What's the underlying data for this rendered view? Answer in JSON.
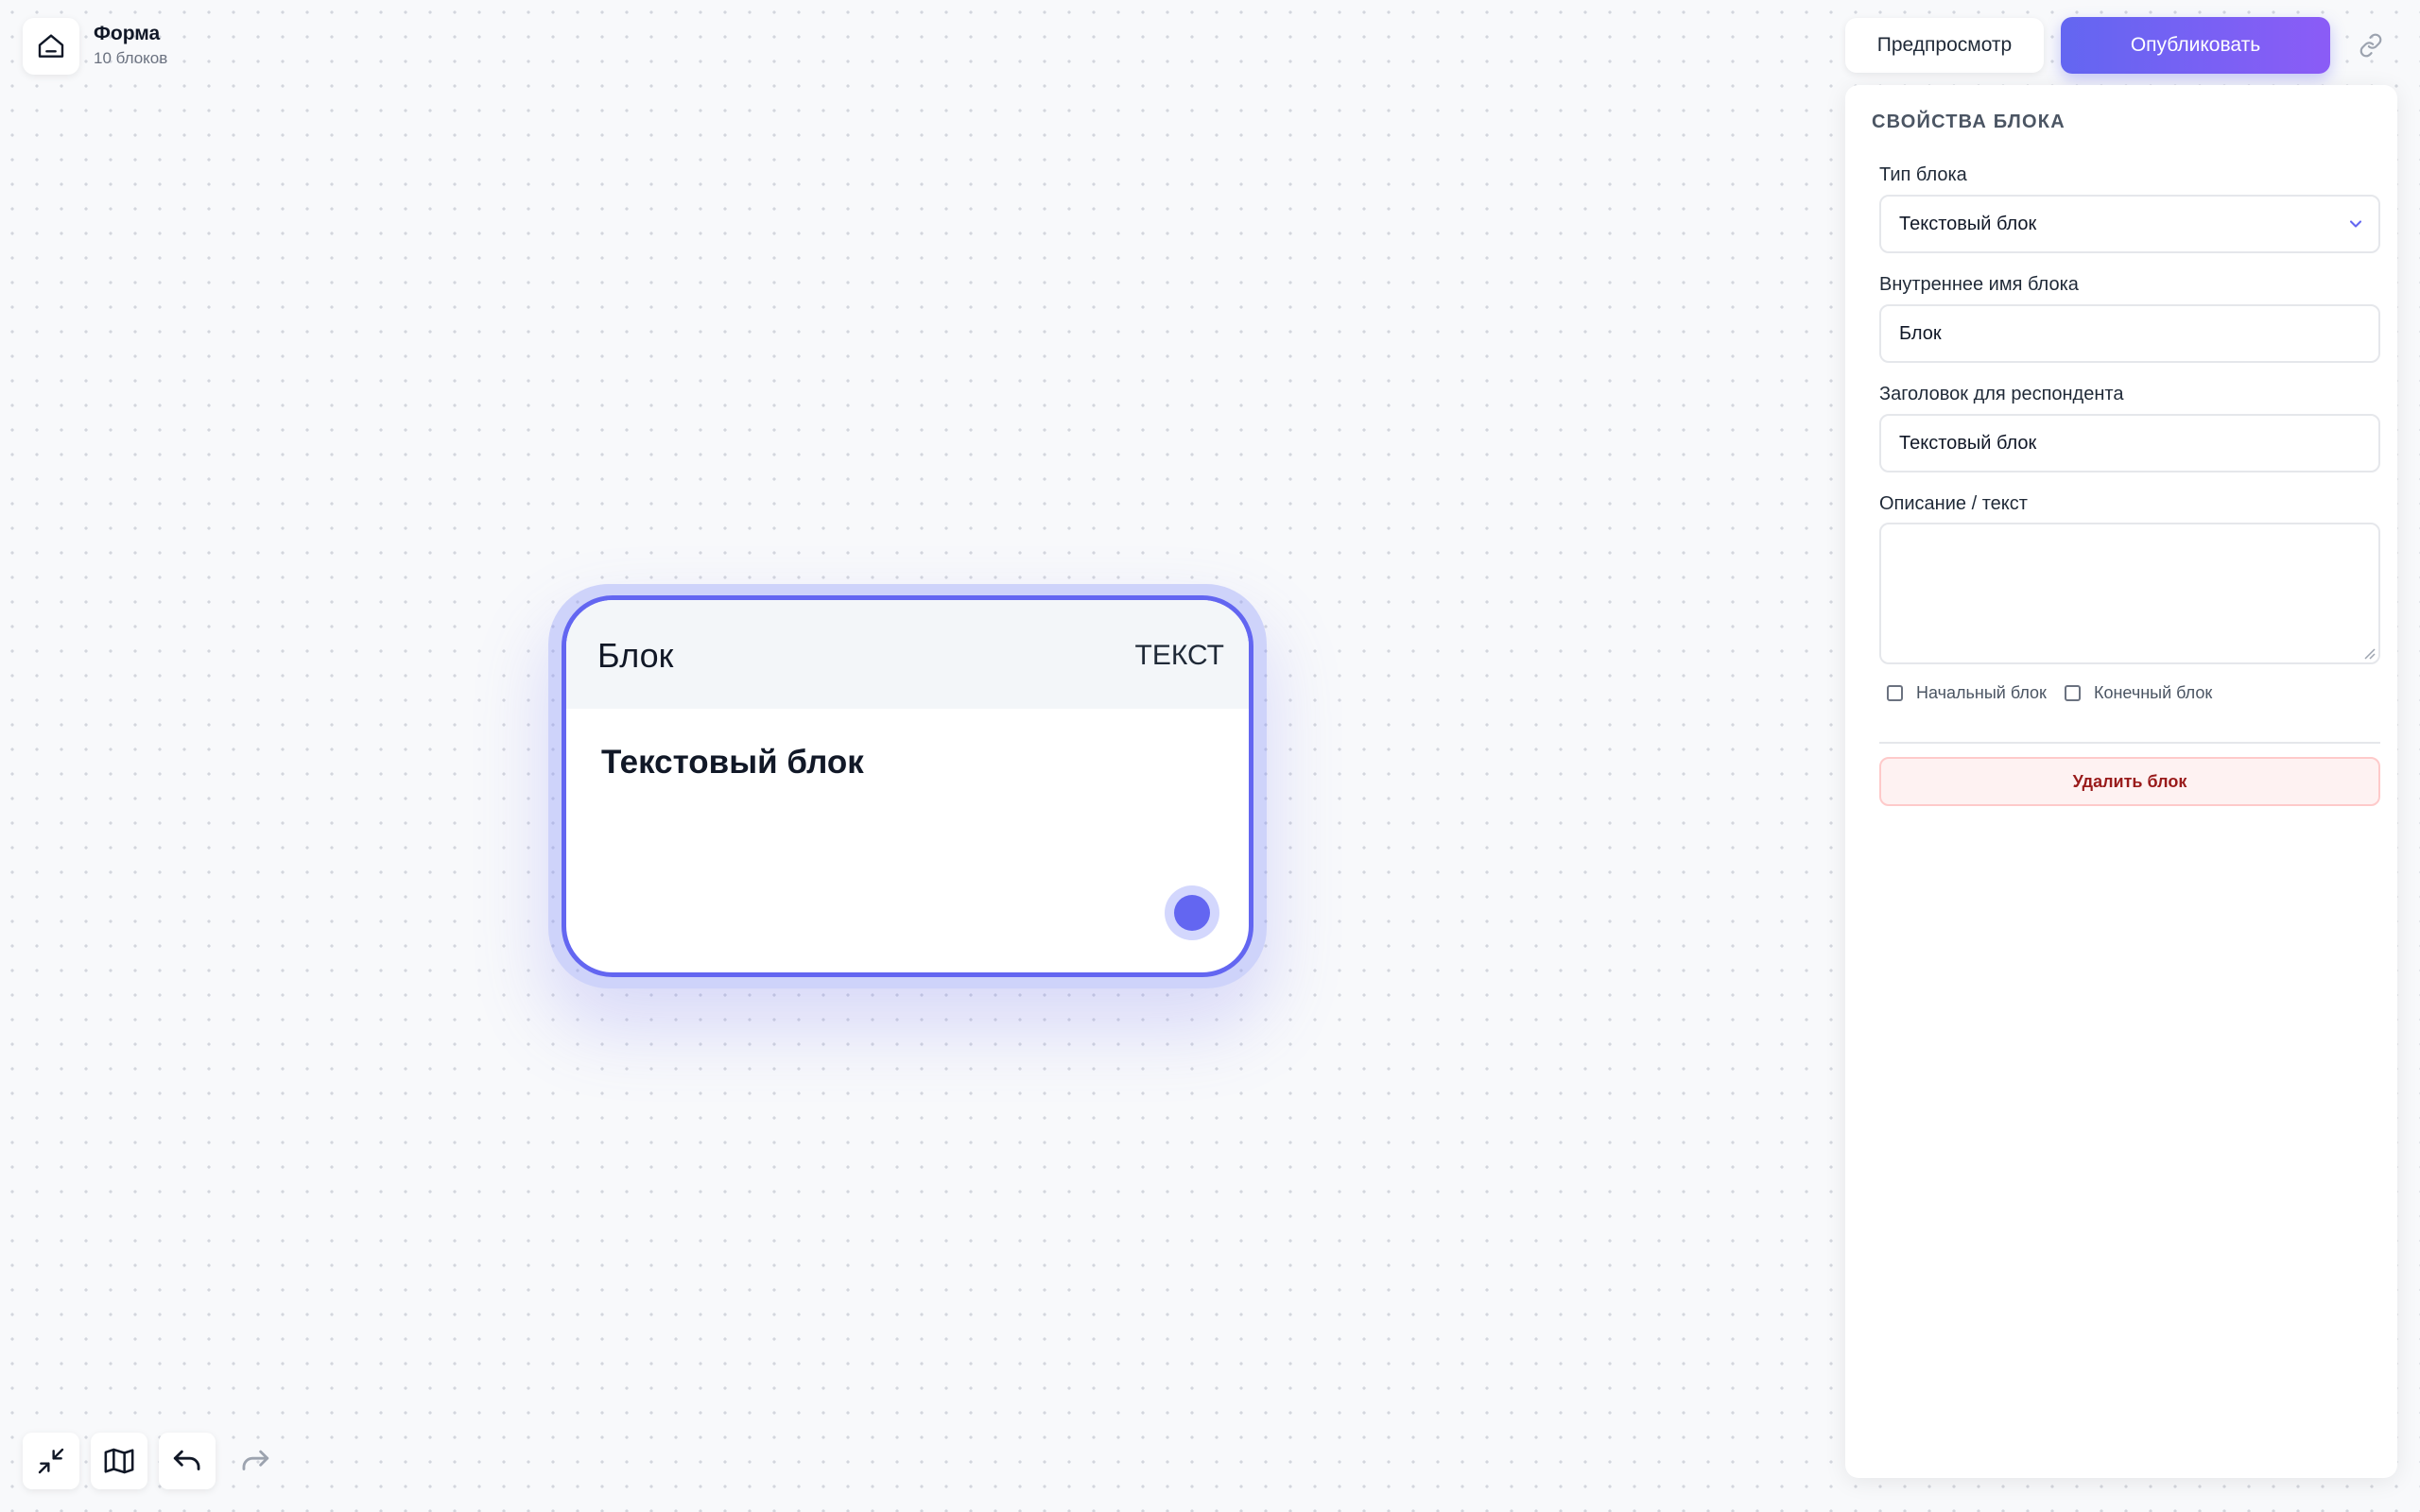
{
  "header": {
    "title": "Форма",
    "subtitle": "10 блоков",
    "home_icon": "home-icon"
  },
  "actions": {
    "preview_label": "Предпросмотр",
    "publish_label": "Опубликовать",
    "link_icon": "link-icon",
    "accent_color": "#6366f1"
  },
  "panel": {
    "heading": "СВОЙСТВА БЛОКА",
    "type_label": "Тип блока",
    "type_value": "Текстовый блок",
    "internal_name_label": "Внутреннее имя блока",
    "internal_name_value": "Блок",
    "respondent_title_label": "Заголовок для респондента",
    "respondent_title_value": "Текстовый блок",
    "description_label": "Описание / текст",
    "description_value": "",
    "start_block_label": "Начальный блок",
    "start_block_checked": false,
    "end_block_label": "Конечный блок",
    "end_block_checked": false,
    "delete_label": "Удалить блок"
  },
  "node": {
    "name": "Блок",
    "type": "ТЕКСТ",
    "heading": "Текстовый блок",
    "selected": true
  },
  "toolbar": {
    "items": [
      "collapse-icon",
      "map-icon",
      "undo-icon",
      "redo-icon"
    ],
    "redo_enabled": false
  }
}
